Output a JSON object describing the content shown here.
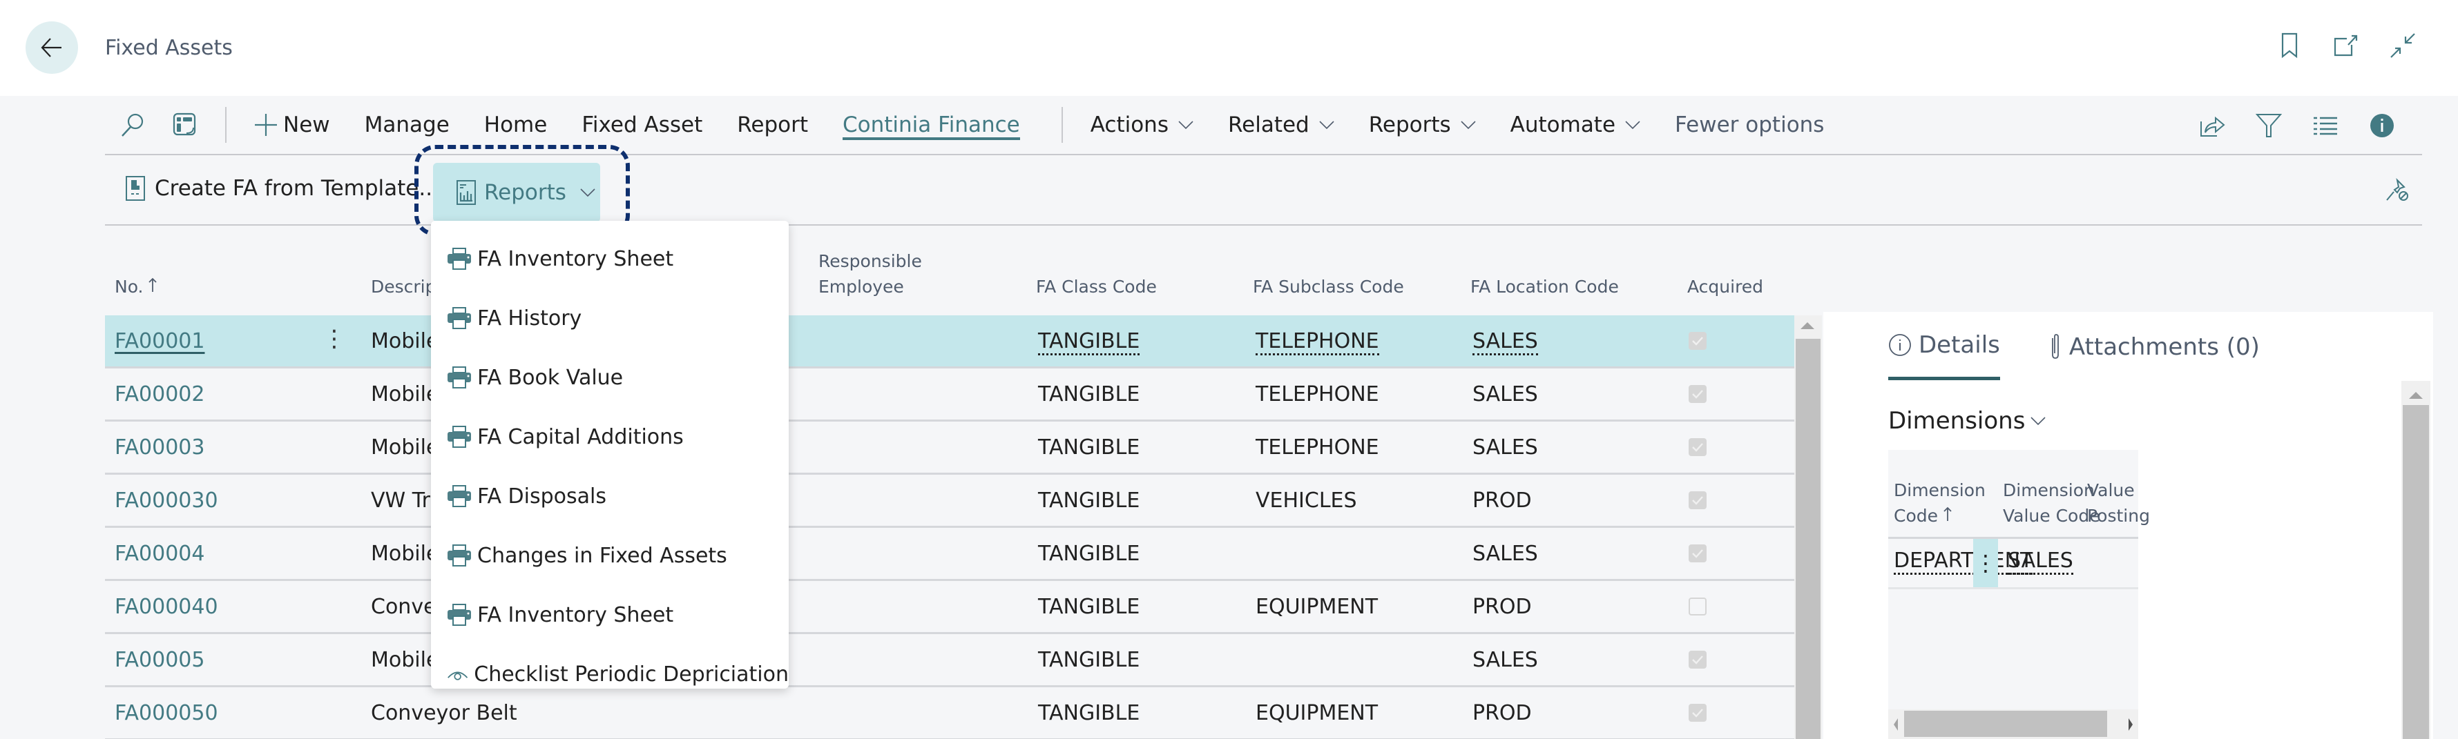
{
  "header": {
    "title": "Fixed Assets",
    "icons": [
      "back-arrow-icon",
      "bookmark-icon",
      "open-new-window-icon",
      "collapse-icon"
    ]
  },
  "actionbar": {
    "items": [
      {
        "label": "New",
        "icon": "plus-icon"
      },
      {
        "label": "Manage"
      },
      {
        "label": "Home"
      },
      {
        "label": "Fixed Asset"
      },
      {
        "label": "Report"
      },
      {
        "label": "Continia Finance",
        "active": true
      }
    ],
    "menus": [
      {
        "label": "Actions"
      },
      {
        "label": "Related"
      },
      {
        "label": "Reports"
      },
      {
        "label": "Automate"
      }
    ],
    "fewer_options": "Fewer options",
    "right_icons": [
      "share-icon",
      "filter-icon",
      "list-view-icon",
      "info-icon"
    ]
  },
  "promoted": {
    "create_label": "Create FA from Template...",
    "reports_label": "Reports"
  },
  "reports_menu": {
    "items": [
      {
        "label": "FA Inventory Sheet",
        "icon": "printer-icon"
      },
      {
        "label": "FA History",
        "icon": "printer-icon"
      },
      {
        "label": "FA Book Value",
        "icon": "printer-icon"
      },
      {
        "label": "FA Capital Additions",
        "icon": "printer-icon"
      },
      {
        "label": "FA Disposals",
        "icon": "printer-icon"
      },
      {
        "label": "Changes in Fixed Assets",
        "icon": "printer-icon"
      },
      {
        "label": "FA Inventory Sheet",
        "icon": "printer-icon"
      },
      {
        "label": "Checklist Periodic Depriciation",
        "icon": "view-icon"
      }
    ]
  },
  "grid": {
    "columns": {
      "no": "No.",
      "description": "Descrip",
      "responsible_1": "Responsible",
      "responsible_2": "Employee",
      "class": "FA Class Code",
      "subclass": "FA Subclass Code",
      "location": "FA Location Code",
      "acquired": "Acquired"
    },
    "rows": [
      {
        "no": "FA00001",
        "description": "Mobile",
        "class": "TANGIBLE",
        "subclass": "TELEPHONE",
        "location": "SALES",
        "acquired": true
      },
      {
        "no": "FA00002",
        "description": "Mobile",
        "class": "TANGIBLE",
        "subclass": "TELEPHONE",
        "location": "SALES",
        "acquired": true
      },
      {
        "no": "FA00003",
        "description": "Mobile",
        "class": "TANGIBLE",
        "subclass": "TELEPHONE",
        "location": "SALES",
        "acquired": true
      },
      {
        "no": "FA000030",
        "description": "VW Tra",
        "class": "TANGIBLE",
        "subclass": "VEHICLES",
        "location": "PROD",
        "acquired": true
      },
      {
        "no": "FA00004",
        "description": "Mobile",
        "class": "TANGIBLE",
        "subclass": "",
        "location": "SALES",
        "acquired": true
      },
      {
        "no": "FA000040",
        "description": "Conve",
        "class": "TANGIBLE",
        "subclass": "EQUIPMENT",
        "location": "PROD",
        "acquired": false
      },
      {
        "no": "FA00005",
        "description": "Mobile",
        "class": "TANGIBLE",
        "subclass": "",
        "location": "SALES",
        "acquired": true
      },
      {
        "no": "FA000050",
        "description": "Conveyor Belt",
        "class": "TANGIBLE",
        "subclass": "EQUIPMENT",
        "location": "PROD",
        "acquired": true
      }
    ]
  },
  "factbox": {
    "tabs": [
      {
        "label": "Details",
        "icon": "info-circle-icon",
        "active": true
      },
      {
        "label": "Attachments (0)",
        "icon": "paperclip-icon"
      }
    ],
    "dimensions_title": "Dimensions",
    "columns": {
      "code_1": "Dimension",
      "code_2": "Code",
      "value_1": "Dimension",
      "value_2": "Value Code",
      "posting_1": "Value",
      "posting_2": "Posting"
    },
    "rows": [
      {
        "code": "DEPARTMENT",
        "value": "SALES",
        "posting": ""
      }
    ]
  },
  "colors": {
    "accent": "#437a83",
    "selected_row": "#c4e7eb",
    "focus_ring": "#0e2f6e"
  }
}
